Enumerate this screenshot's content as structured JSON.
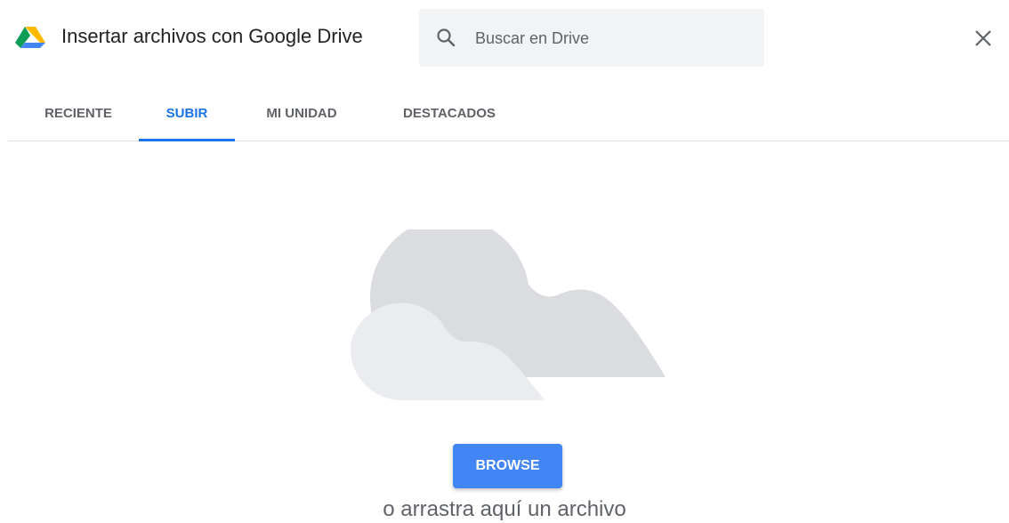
{
  "header": {
    "title": "Insertar archivos con Google Drive",
    "logo_icon": "google-drive-logo",
    "close_icon": "close-icon"
  },
  "search": {
    "placeholder": "Buscar en Drive",
    "value": "",
    "icon": "search-icon"
  },
  "tabs": [
    {
      "label": "RECIENTE",
      "active": false
    },
    {
      "label": "SUBIR",
      "active": true
    },
    {
      "label": "MI UNIDAD",
      "active": false
    },
    {
      "label": "DESTACADOS",
      "active": false
    }
  ],
  "upload": {
    "illustration": "cloud-illustration",
    "browse_label": "BROWSE",
    "drop_hint": "o arrastra aquí un archivo"
  },
  "colors": {
    "accent": "#1a73e8",
    "button": "#4285f4",
    "search_bg": "#f1f3f4",
    "cloud_back": "#dadce0",
    "cloud_front": "#ebecef"
  }
}
